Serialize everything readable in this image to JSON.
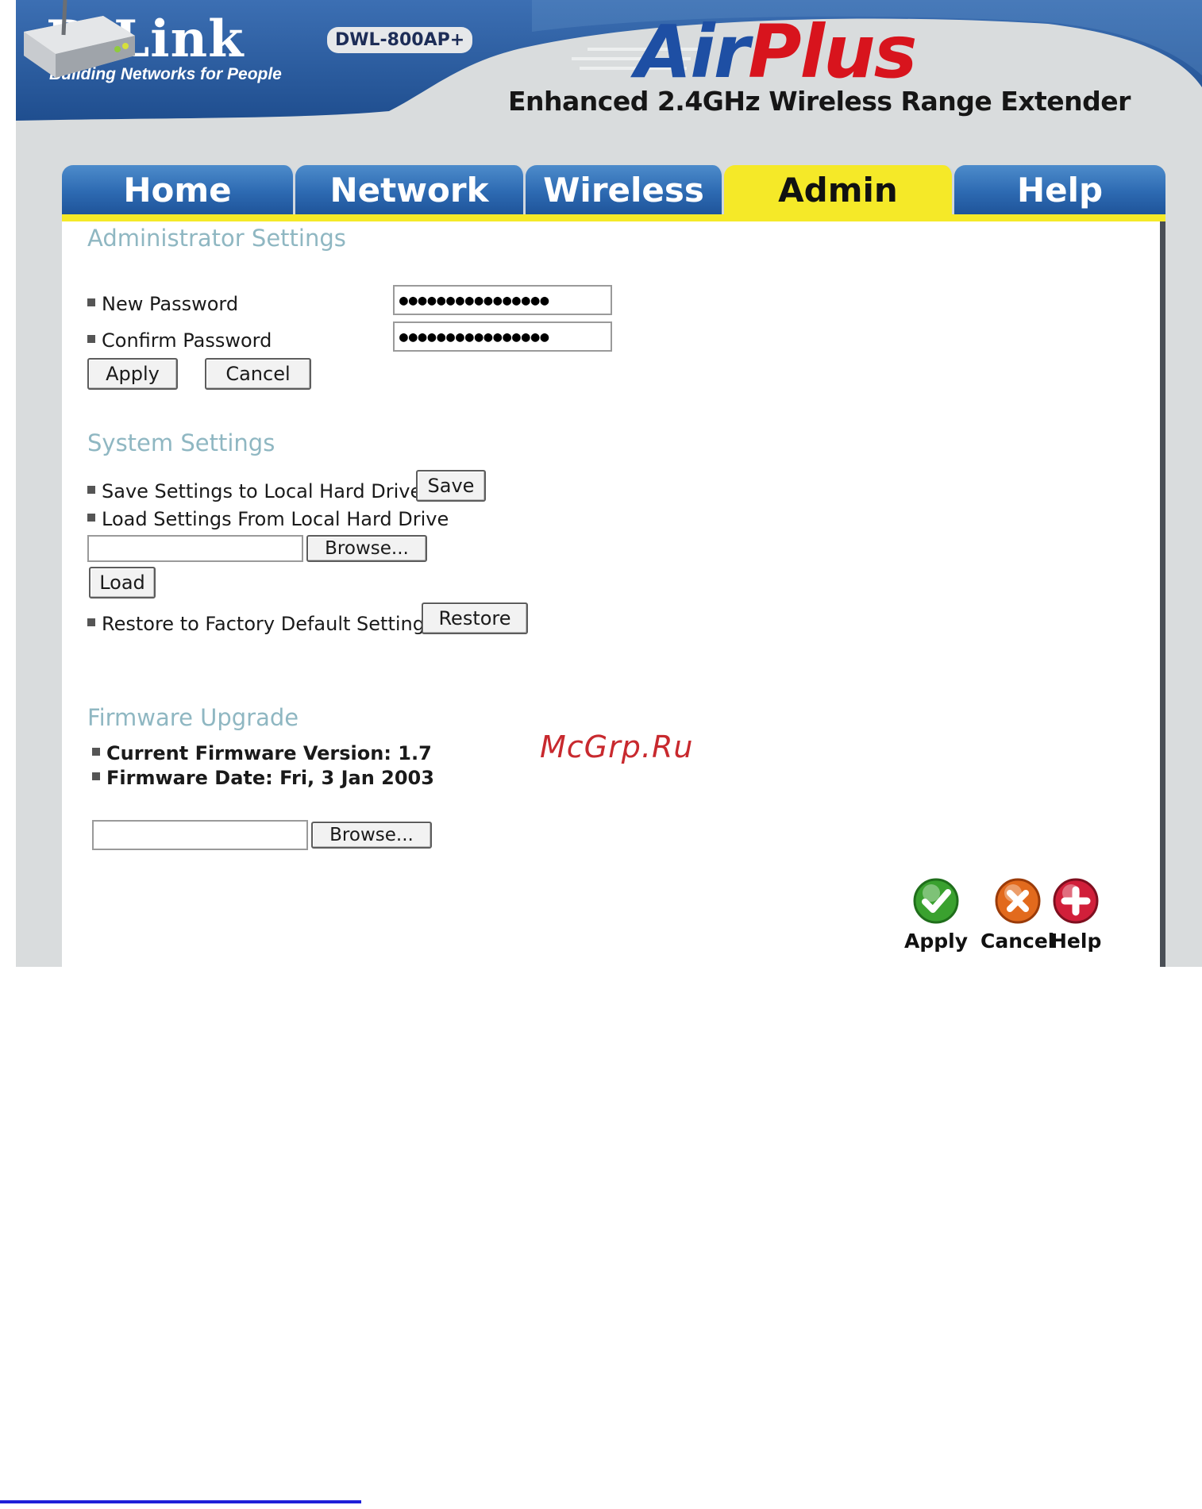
{
  "header": {
    "brand_name": "D-Link",
    "brand_tagline": "Building Networks for People",
    "model": "DWL-800AP+",
    "product_name_air": "Air",
    "product_name_plus": "Plus",
    "product_subtitle": "Enhanced 2.4GHz Wireless Range Extender"
  },
  "tabs": [
    {
      "label": "Home"
    },
    {
      "label": "Network"
    },
    {
      "label": "Wireless"
    },
    {
      "label": "Admin",
      "active": true
    },
    {
      "label": "Help"
    }
  ],
  "admin": {
    "title": "Administrator Settings",
    "new_password_label": "New Password",
    "new_password_value": "●●●●●●●●●●●●●●●●",
    "confirm_password_label": "Confirm Password",
    "confirm_password_value": "●●●●●●●●●●●●●●●●",
    "apply_label": "Apply",
    "cancel_label": "Cancel"
  },
  "system": {
    "title": "System Settings",
    "save_label": "Save Settings to Local Hard Drive",
    "save_button": "Save",
    "load_label": "Load Settings From Local Hard Drive",
    "load_file_value": "",
    "browse_button": "Browse...",
    "load_button": "Load",
    "restore_label": "Restore to Factory Default Settings",
    "restore_button": "Restore"
  },
  "firmware": {
    "title": "Firmware Upgrade",
    "version_text": "Current Firmware Version: 1.7",
    "date_text": "Firmware Date: Fri, 3 Jan 2003",
    "file_value": "",
    "browse_button": "Browse..."
  },
  "actions": {
    "apply_label": "Apply",
    "cancel_label": "Cancel",
    "help_label": "Help",
    "apply_color": "#3aa12f",
    "cancel_color": "#e26a1d",
    "help_color": "#d11f3a"
  },
  "watermark": "McGrp.Ru",
  "colors": {
    "header_blue": "#2a5c9e",
    "tab_blue": "#2d6ab2",
    "tab_active": "#f5e928",
    "section_title": "#8fb7c2"
  }
}
